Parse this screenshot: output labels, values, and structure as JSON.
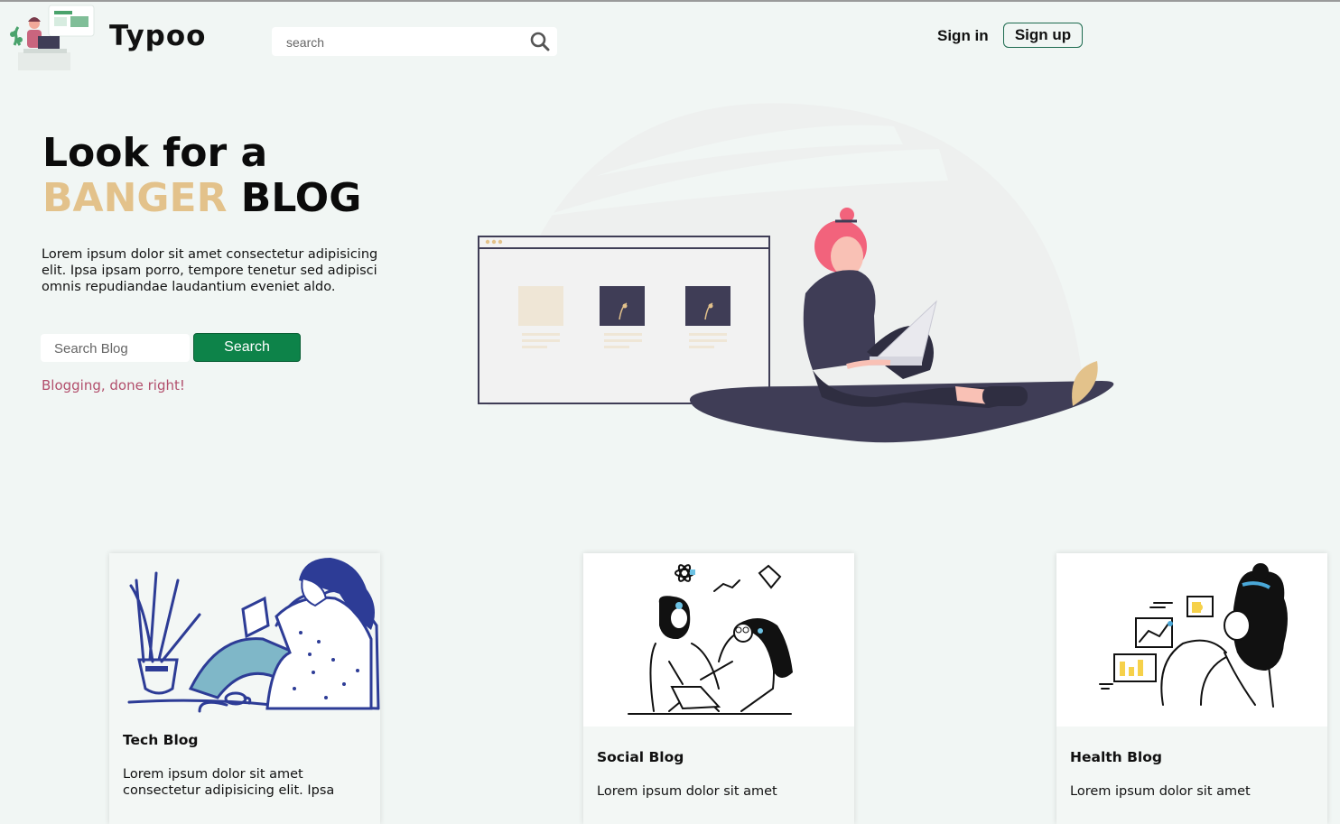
{
  "nav": {
    "brand": "Typoo",
    "search_placeholder": "search",
    "signin_label": "Sign in",
    "signup_label": "Sign up"
  },
  "hero": {
    "title_line1": "Look for a",
    "title_accent": "BANGER",
    "title_rest": "BLOG",
    "text": "Lorem ipsum dolor sit amet consectetur adipisicing elit. Ipsa ipsam porro, tempore tenetur sed adipisci omnis repudiandae laudantium eveniet aldo.",
    "search_placeholder": "Search Blog",
    "search_button": "Search",
    "tagline": "Blogging, done right!"
  },
  "cards": [
    {
      "title": "Tech Blog",
      "text": "Lorem ipsum dolor sit amet consectetur adipisicing elit. Ipsa"
    },
    {
      "title": "Social Blog",
      "text": "Lorem ipsum dolor sit amet"
    },
    {
      "title": "Health Blog",
      "text": "Lorem ipsum dolor sit amet"
    }
  ],
  "colors": {
    "background": "#f1f6f4",
    "accent_gold": "#e3c28b",
    "button_green": "#0d8349",
    "tagline_pink": "#b24f6c",
    "illustration_dark": "#3f3d56",
    "illustration_pink": "#f2637c"
  },
  "icons": [
    "logo-illustration",
    "search-icon",
    "hero-illustration",
    "tech-illustration",
    "social-illustration",
    "health-illustration"
  ]
}
